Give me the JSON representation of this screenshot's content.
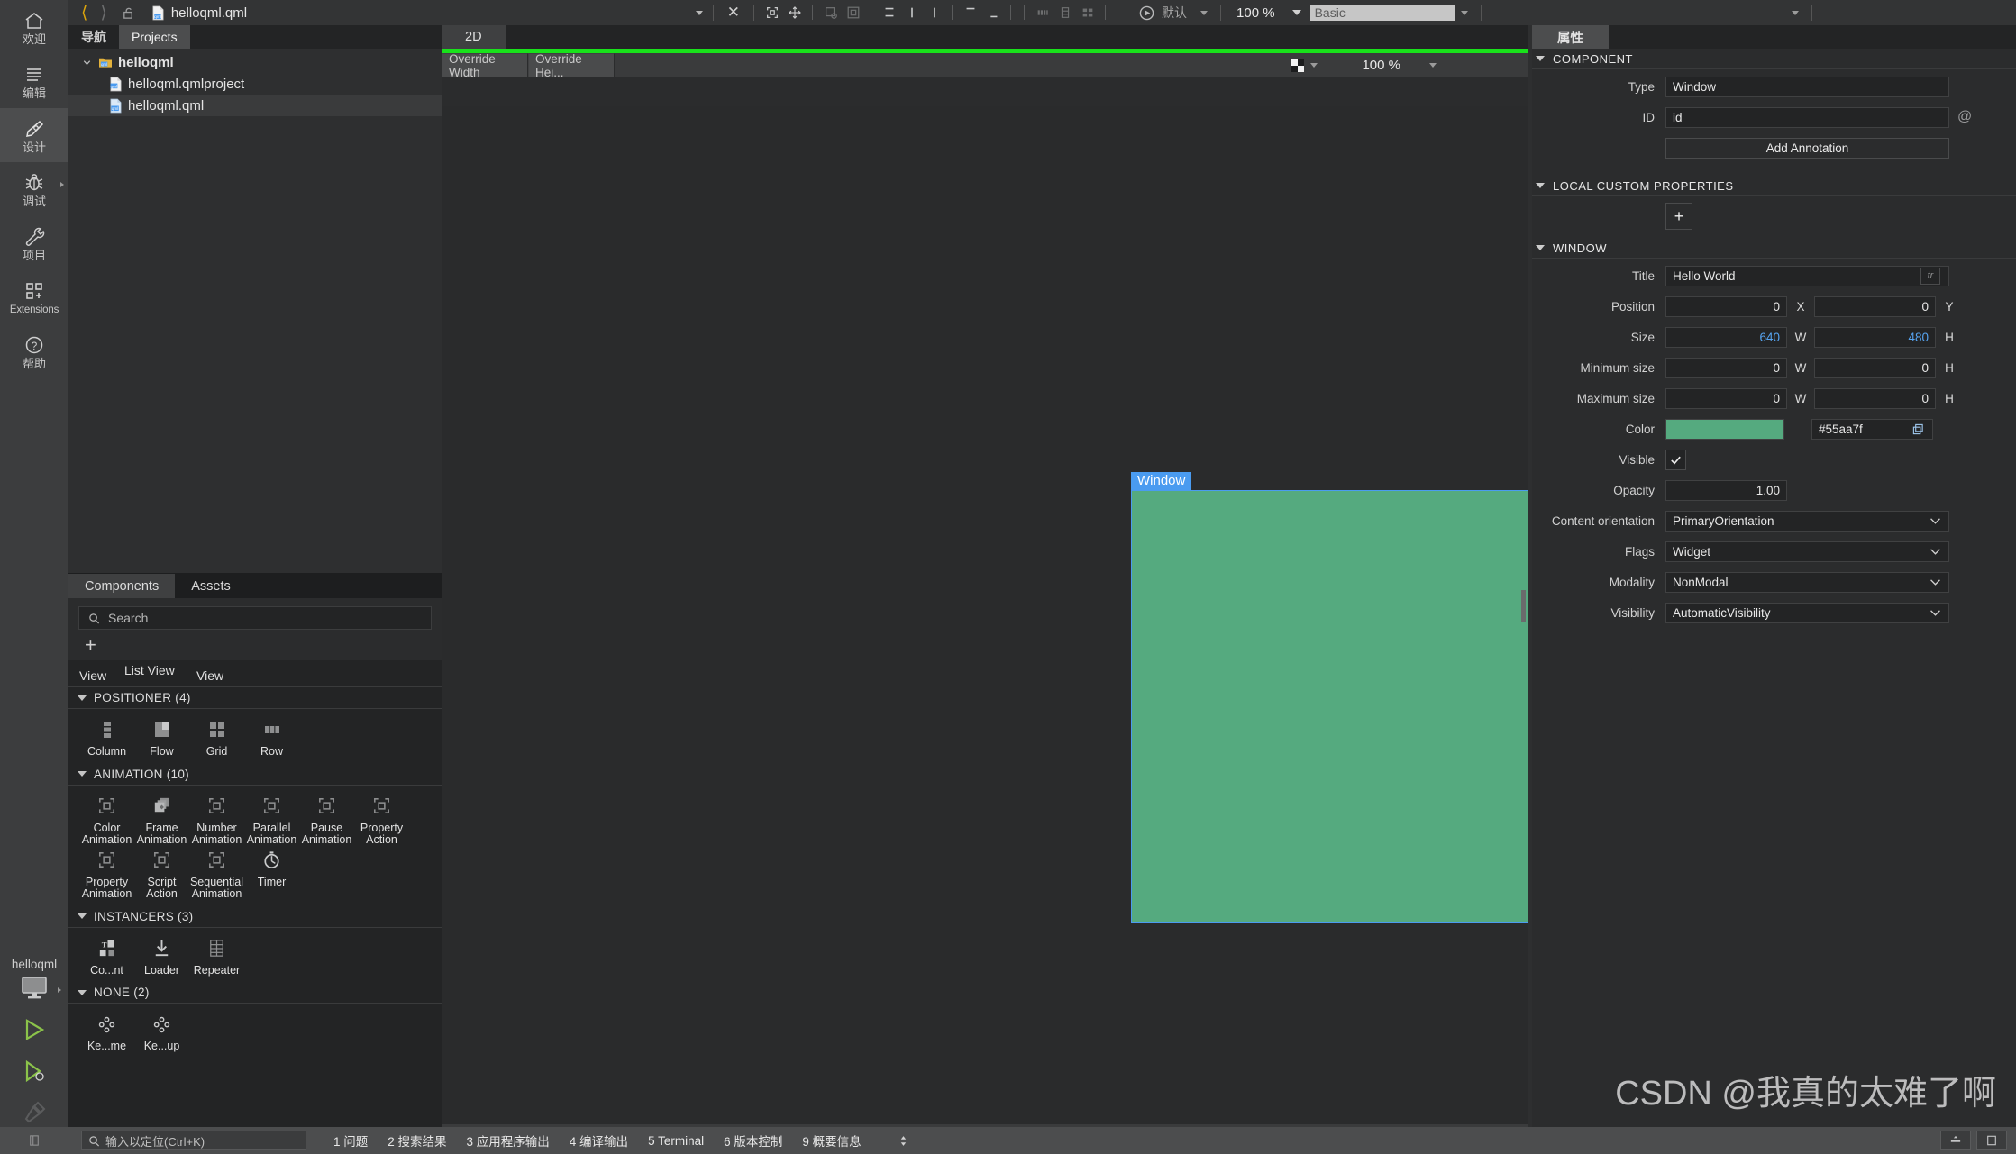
{
  "colors": {
    "accent_blue": "#4a9bf0",
    "green_bar": "#19e21b",
    "window_color": "#55aa7f",
    "panel_bg": "#2b2c2d",
    "mode_bg": "#3c3d3e",
    "number_accent": "#56a3ef"
  },
  "modebar": {
    "items": [
      {
        "label": "欢迎",
        "icon": "home-icon",
        "active": false
      },
      {
        "label": "编辑",
        "icon": "edit-lines-icon",
        "active": false
      },
      {
        "label": "设计",
        "icon": "design-pen-icon",
        "active": true
      },
      {
        "label": "调试",
        "icon": "bug-icon",
        "active": false,
        "has_arrow": true
      },
      {
        "label": "项目",
        "icon": "wrench-icon",
        "active": false
      },
      {
        "label": "Extensions",
        "icon": "extensions-grid-icon",
        "active": false
      },
      {
        "label": "帮助",
        "icon": "question-circle-icon",
        "active": false
      }
    ],
    "kit_name": "helloqml",
    "kit_icon": "desktop-monitor-icon",
    "run_icon": "run-triangle-icon",
    "debug_run_icon": "debug-run-icon",
    "build_icon": "hammer-icon"
  },
  "topbar": {
    "back_icon": "chevron-left-icon",
    "forward_icon": "chevron-right-icon",
    "lock_icon": "unlocked-padlock-icon",
    "file_icon": "qml-file-icon",
    "filename": "helloqml.qml",
    "dropdown_icon": "chevron-down-icon",
    "close_icon": "close-x-icon",
    "tools": [
      "select-frame-icon",
      "move-icon",
      "snap-to-icon",
      "align-outer-icon",
      "align-top-icon",
      "align-left-icon",
      "align-right-icon",
      "distribute-top-icon",
      "distribute-bottom-icon",
      "columns-icon",
      "rows-icon",
      "grid-layout-icon"
    ],
    "preview_icon": "record-circle-icon",
    "preset_label": "默认",
    "zoom_label": "100 %",
    "style_value": "Basic"
  },
  "navigator": {
    "tabs": [
      {
        "label": "导航",
        "active": false
      },
      {
        "label": "Projects",
        "active": true
      }
    ],
    "tree": [
      {
        "label": "helloqml",
        "depth": 0,
        "bold": true,
        "expanded": true,
        "icon": "folder-qml-icon",
        "selected": false
      },
      {
        "label": "helloqml.qmlproject",
        "depth": 1,
        "bold": false,
        "icon": "qmlproject-file-icon",
        "selected": false
      },
      {
        "label": "helloqml.qml",
        "depth": 1,
        "bold": false,
        "icon": "qml-file-icon",
        "selected": true
      }
    ]
  },
  "components": {
    "tabs": [
      {
        "label": "Components",
        "active": true
      },
      {
        "label": "Assets",
        "active": false
      }
    ],
    "search_placeholder": "Search",
    "search_icon": "search-icon",
    "add_icon": "plus-icon",
    "clipped_strip": [
      "View",
      "List View",
      "View"
    ],
    "sections": [
      {
        "title": "POSITIONER (4)",
        "items": [
          {
            "label": "Column",
            "icon": "column-positioner-icon"
          },
          {
            "label": "Flow",
            "icon": "flow-positioner-icon"
          },
          {
            "label": "Grid",
            "icon": "grid-positioner-icon"
          },
          {
            "label": "Row",
            "icon": "row-positioner-icon"
          }
        ]
      },
      {
        "title": "ANIMATION (10)",
        "items": [
          {
            "label": "Color Animation",
            "icon": "animation-placeholder-icon"
          },
          {
            "label": "Frame Animation",
            "icon": "frame-animation-icon"
          },
          {
            "label": "Number Animation",
            "icon": "animation-placeholder-icon"
          },
          {
            "label": "Parallel Animation",
            "icon": "animation-placeholder-icon"
          },
          {
            "label": "Pause Animation",
            "icon": "animation-placeholder-icon"
          },
          {
            "label": "Property Action",
            "icon": "animation-placeholder-icon"
          },
          {
            "label": "Property Animation",
            "icon": "animation-placeholder-icon"
          },
          {
            "label": "Script Action",
            "icon": "animation-placeholder-icon"
          },
          {
            "label": "Sequential Animation",
            "icon": "animation-placeholder-icon"
          },
          {
            "label": "Timer",
            "icon": "timer-icon"
          }
        ]
      },
      {
        "title": "INSTANCERS (3)",
        "items": [
          {
            "label": "Co...nt",
            "icon": "component-mixed-icon"
          },
          {
            "label": "Loader",
            "icon": "loader-download-icon"
          },
          {
            "label": "Repeater",
            "icon": "repeater-table-icon"
          }
        ]
      },
      {
        "title": "NONE (2)",
        "items": [
          {
            "label": "Ke...me",
            "icon": "keyframe-group-icon"
          },
          {
            "label": "Ke...up",
            "icon": "keyframe-group-icon"
          }
        ]
      }
    ]
  },
  "canvas": {
    "tabs": [
      {
        "label": "2D",
        "active": true
      }
    ],
    "override_width_label": "Override Width",
    "override_height_label": "Override Hei...",
    "checker_icon": "checkerboard-bg-icon",
    "zoom_label": "100 %",
    "selection_label": "Window"
  },
  "properties": {
    "tab_label": "属性",
    "sections": [
      {
        "title": "COMPONENT"
      },
      {
        "title": "LOCAL CUSTOM PROPERTIES"
      },
      {
        "title": "WINDOW"
      }
    ],
    "component": {
      "type_label": "Type",
      "type_value": "Window",
      "id_label": "ID",
      "id_value": "id",
      "at_icon": "at-sign-icon",
      "add_annotation_label": "Add Annotation"
    },
    "local_custom": {
      "add_label": "+"
    },
    "window": {
      "title_label": "Title",
      "title_value": "Hello World",
      "tr_badge": "tr",
      "position_label": "Position",
      "position_x": "0",
      "position_y": "0",
      "unit_x": "X",
      "unit_y": "Y",
      "size_label": "Size",
      "size_w": "640",
      "size_h": "480",
      "unit_w": "W",
      "unit_h": "H",
      "min_size_label": "Minimum size",
      "min_w": "0",
      "min_h": "0",
      "max_size_label": "Maximum size",
      "max_w": "0",
      "max_h": "0",
      "color_label": "Color",
      "color_value": "#55aa7f",
      "copy_icon": "copy-icon",
      "visible_label": "Visible",
      "visible_checked": true,
      "check_icon": "checkmark-icon",
      "opacity_label": "Opacity",
      "opacity_value": "1.00",
      "content_orientation_label": "Content orientation",
      "content_orientation_value": "PrimaryOrientation",
      "flags_label": "Flags",
      "flags_value": "Widget",
      "modality_label": "Modality",
      "modality_value": "NonModal",
      "visibility_label": "Visibility",
      "visibility_value": "AutomaticVisibility",
      "chevron_icon": "chevron-down-icon"
    }
  },
  "statusbar": {
    "locate_placeholder": "输入以定位(Ctrl+K)",
    "locate_icon": "search-icon",
    "left_icon": "sidebar-toggle-icon",
    "items": [
      "1 问题",
      "2 搜索结果",
      "3 应用程序输出",
      "4 编译输出",
      "5 Terminal",
      "6 版本控制",
      "9 概要信息"
    ],
    "updown_icon": "up-down-arrows-icon",
    "right_boxes": [
      "progress-box-icon",
      "panel-box-icon"
    ]
  },
  "watermark": "CSDN @我真的太难了啊"
}
